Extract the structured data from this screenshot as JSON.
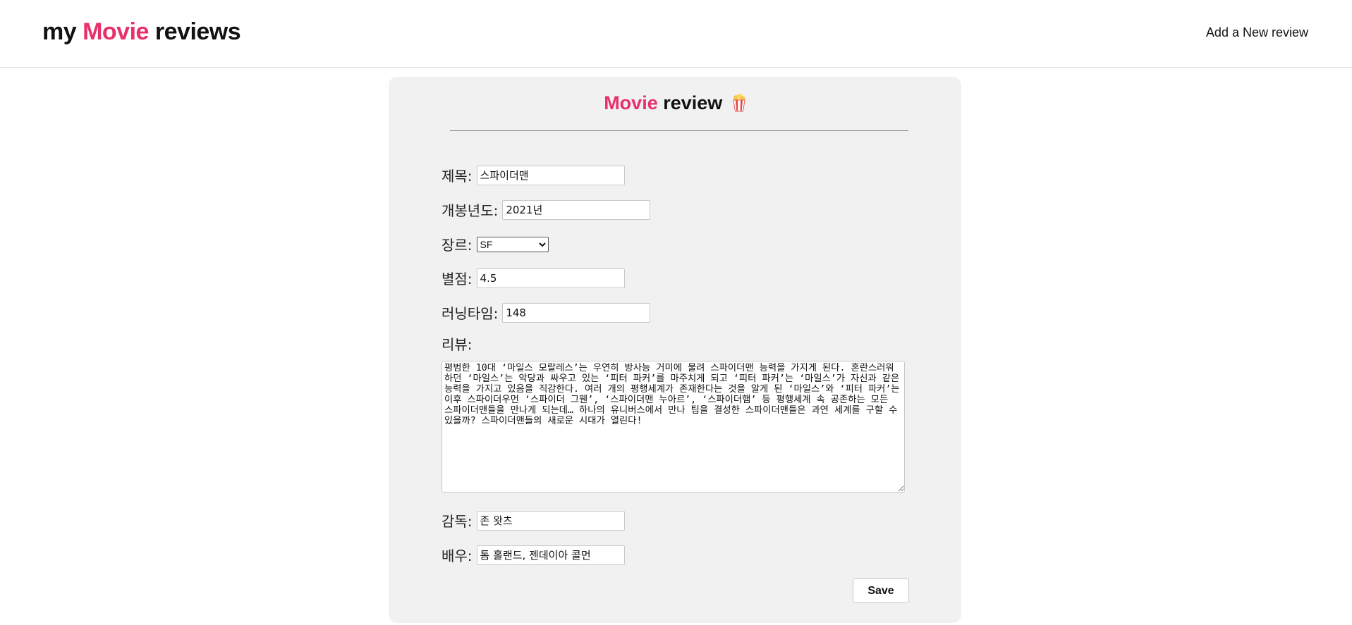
{
  "header": {
    "logo_prefix": "my",
    "logo_accent": "Movie",
    "logo_suffix": "reviews",
    "nav_link": "Add a New review"
  },
  "card": {
    "title_accent": "Movie",
    "title_rest": "review"
  },
  "form": {
    "title": {
      "label": "제목:",
      "value": "스파이더맨"
    },
    "year": {
      "label": "개봉년도:",
      "value": "2021년"
    },
    "genre": {
      "label": "장르:",
      "value": "SF"
    },
    "rating": {
      "label": "별점:",
      "value": "4.5"
    },
    "runtime": {
      "label": "러닝타임:",
      "value": "148"
    },
    "review": {
      "label": "리뷰:",
      "value": "평범한 10대 ‘마일스 모랄레스’는 우연히 방사능 거미에 물려 스파이더맨 능력을 가지게 된다. 혼란스러워하던 ‘마일스’는 악당과 싸우고 있는 ‘피터 파커’를 마주치게 되고 ‘피터 파커’는 ‘마일스’가 자신과 같은 능력을 가지고 있음을 직감한다. 여러 개의 평행세계가 존재한다는 것을 알게 된 ‘마일스’와 ‘피터 파커’는 이후 스파이더우먼 ‘스파이더 그웬’, ‘스파이더맨 누아르’, ‘스파이더햄’ 등 평행세계 속 공존하는 모든 스파이더맨들을 만나게 되는데… 하나의 유니버스에서 만나 팀을 결성한 스파이더맨들은 과연 세계를 구할 수 있을까? 스파이더맨들의 새로운 시대가 열린다!"
    },
    "director": {
      "label": "감독:",
      "value": "존 왓츠"
    },
    "actors": {
      "label": "배우:",
      "value": "톰 홀랜드, 젠데이아 콜먼"
    },
    "save_label": "Save"
  },
  "colors": {
    "accent": "#e8306a",
    "card_bg": "#f1f1f1"
  },
  "icons": {
    "title_icon": "popcorn-icon"
  }
}
